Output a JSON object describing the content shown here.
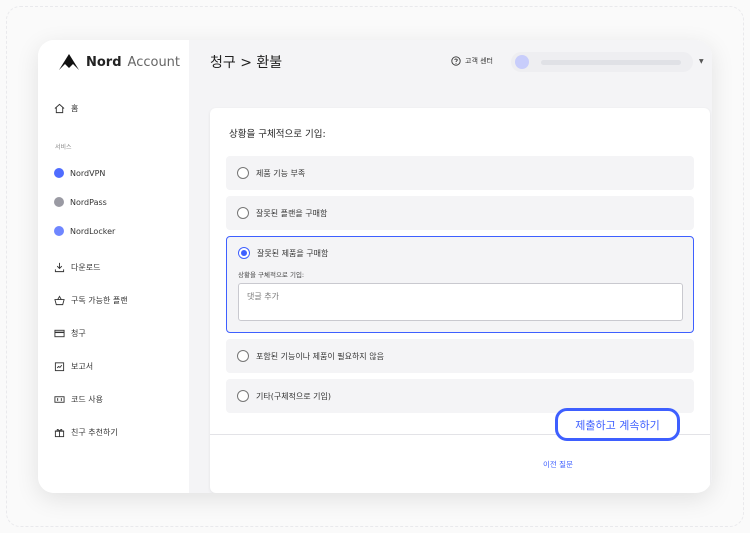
{
  "brand": {
    "name": "Nord",
    "product": "Account"
  },
  "sidebar": {
    "home": "홈",
    "services_heading": "서비스",
    "services": [
      {
        "label": "NordVPN",
        "color": "#4f6cff"
      },
      {
        "label": "NordPass",
        "color": "#9a9aa3"
      },
      {
        "label": "NordLocker",
        "color": "#6f86ff"
      }
    ],
    "items": [
      {
        "label": "다운로드"
      },
      {
        "label": "구독 가능한 플랜"
      },
      {
        "label": "청구"
      },
      {
        "label": "보고서"
      },
      {
        "label": "코드 사용"
      },
      {
        "label": "친구 추천하기"
      }
    ]
  },
  "header": {
    "breadcrumb": "청구 > 환불",
    "help": "고객 센터"
  },
  "form": {
    "prompt": "상황을 구체적으로 기입:",
    "options": [
      {
        "label": "제품 기능 부족",
        "selected": false
      },
      {
        "label": "잘못된 플랜을 구매함",
        "selected": false
      },
      {
        "label": "잘못된 제품을 구매함",
        "selected": true
      },
      {
        "label": "포함된 기능이나 제품이 필요하지 않음",
        "selected": false
      },
      {
        "label": "기타(구체적으로 기입)",
        "selected": false
      }
    ],
    "detail_label": "상황을 구체적으로 기입:",
    "comment_placeholder": "댓글 추가",
    "prev_link": "이전 질문",
    "submit": "제출하고 계속하기"
  },
  "colors": {
    "accent": "#3e5fff"
  }
}
